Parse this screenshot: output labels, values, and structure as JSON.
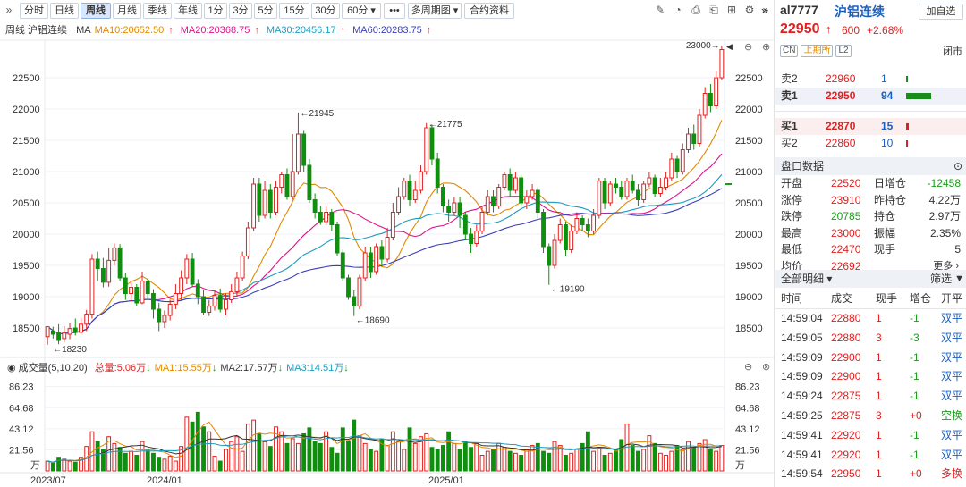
{
  "toolbar": {
    "expand_left": "»",
    "periods": [
      "分时",
      "日线",
      "周线",
      "月线",
      "季线",
      "年线",
      "1分",
      "3分",
      "5分",
      "15分",
      "30分"
    ],
    "active_period": "周线",
    "period_select": "60分 ▾",
    "more": "•••",
    "multi_period": "多周期图 ▾",
    "contract_info": "合约资料",
    "expand_right": "»"
  },
  "ma_legend": {
    "title": "周线 沪铝连续",
    "ma_label": "MA",
    "items": [
      {
        "text": "MA10:20652.50",
        "color": "#e08a00"
      },
      {
        "text": "MA20:20368.75",
        "color": "#e0138c"
      },
      {
        "text": "MA30:20456.17",
        "color": "#1c9bbf"
      },
      {
        "text": "MA60:20283.75",
        "color": "#3a3fb8"
      }
    ]
  },
  "vol_legend": {
    "title": "成交量(5,10,20)",
    "total": "总量:5.06万",
    "items": [
      {
        "text": "MA1:15.55万",
        "color": "#e08a00"
      },
      {
        "text": "MA2:17.57万",
        "color": "#333333"
      },
      {
        "text": "MA3:14.51万",
        "color": "#1c9bbf"
      }
    ]
  },
  "axis": {
    "price_ticks": [
      "22500",
      "22000",
      "21500",
      "21000",
      "20500",
      "20000",
      "19500",
      "19000",
      "18500"
    ],
    "vol_ticks": [
      "86.23",
      "64.68",
      "43.12",
      "21.56"
    ],
    "vol_unit": "万",
    "dates": [
      "2023/07",
      "2024/01",
      "2025/01"
    ]
  },
  "annotations": {
    "high": "23000",
    "p21945": "←21945",
    "p21775": "←21775",
    "p18690": "←18690",
    "p19190": "←19190",
    "p18230": "←18230"
  },
  "chart_data": {
    "type": "candlestick",
    "title": "周线 沪铝连续",
    "ylim": [
      18100,
      23100
    ],
    "vol_ylim": [
      0,
      96
    ],
    "candles": [
      [
        18360,
        18520,
        18230,
        18450
      ],
      [
        18450,
        18400,
        18330,
        18520
      ],
      [
        18420,
        18300,
        18240,
        18560
      ],
      [
        18330,
        18420,
        18270,
        18530
      ],
      [
        18400,
        18490,
        18320,
        18580
      ],
      [
        18500,
        18430,
        18380,
        18650
      ],
      [
        18430,
        18560,
        18400,
        18670
      ],
      [
        18560,
        18720,
        18450,
        18790
      ],
      [
        18720,
        19600,
        18650,
        19680
      ],
      [
        19600,
        19450,
        19250,
        19720
      ],
      [
        19450,
        19230,
        19150,
        19620
      ],
      [
        19230,
        19580,
        19160,
        19780
      ],
      [
        19580,
        19780,
        19500,
        19850
      ],
      [
        19780,
        19300,
        19250,
        19840
      ],
      [
        19300,
        19050,
        18950,
        19380
      ],
      [
        19050,
        19150,
        18920,
        19250
      ],
      [
        19150,
        18900,
        18850,
        19200
      ],
      [
        18900,
        19250,
        18880,
        19400
      ],
      [
        19250,
        19050,
        18950,
        19290
      ],
      [
        19050,
        18800,
        18650,
        19120
      ],
      [
        18800,
        18600,
        18450,
        18900
      ],
      [
        18600,
        18700,
        18500,
        18780
      ],
      [
        18700,
        18880,
        18620,
        18950
      ],
      [
        18880,
        19050,
        18800,
        19200
      ],
      [
        19050,
        19300,
        18950,
        19420
      ],
      [
        19300,
        19600,
        19200,
        19680
      ],
      [
        19600,
        19200,
        19150,
        19700
      ],
      [
        19200,
        19000,
        18880,
        19280
      ],
      [
        19000,
        18750,
        18700,
        19100
      ],
      [
        18750,
        18850,
        18690,
        18950
      ],
      [
        18850,
        19020,
        18780,
        19100
      ],
      [
        19020,
        18800,
        18750,
        19130
      ],
      [
        18800,
        18950,
        18700,
        19050
      ],
      [
        18950,
        19080,
        18900,
        19200
      ],
      [
        19080,
        19300,
        19000,
        19400
      ],
      [
        19300,
        19650,
        19250,
        19720
      ],
      [
        19650,
        20100,
        19600,
        20200
      ],
      [
        20100,
        20800,
        20050,
        20900
      ],
      [
        20800,
        20300,
        20200,
        20900
      ],
      [
        20300,
        20700,
        20250,
        20850
      ],
      [
        20700,
        20350,
        20250,
        20800
      ],
      [
        20350,
        20750,
        20300,
        20850
      ],
      [
        20750,
        20950,
        20650,
        21000
      ],
      [
        20950,
        20600,
        20550,
        21050
      ],
      [
        20600,
        21000,
        20550,
        21600
      ],
      [
        21000,
        21600,
        20950,
        21945
      ],
      [
        21600,
        21100,
        21000,
        21650
      ],
      [
        21100,
        20550,
        20500,
        21200
      ],
      [
        20550,
        20350,
        20250,
        20650
      ],
      [
        20350,
        20200,
        20150,
        20450
      ],
      [
        20200,
        20350,
        20150,
        20450
      ],
      [
        20350,
        20150,
        20050,
        20400
      ],
      [
        20150,
        19700,
        19650,
        20200
      ],
      [
        19700,
        19300,
        19250,
        19750
      ],
      [
        19300,
        19000,
        18950,
        19350
      ],
      [
        19000,
        18850,
        18690,
        19100
      ],
      [
        18850,
        19300,
        18800,
        19350
      ],
      [
        19300,
        19700,
        19250,
        19800
      ],
      [
        19700,
        19400,
        19300,
        19800
      ],
      [
        19400,
        19800,
        19350,
        19850
      ],
      [
        19800,
        19600,
        19500,
        19900
      ],
      [
        19600,
        19950,
        19550,
        20100
      ],
      [
        19950,
        20350,
        19900,
        20500
      ],
      [
        20350,
        20600,
        20300,
        20750
      ],
      [
        20600,
        20850,
        20550,
        20900
      ],
      [
        20850,
        20550,
        20450,
        20950
      ],
      [
        20550,
        20700,
        20500,
        20850
      ],
      [
        20700,
        21000,
        20650,
        21100
      ],
      [
        21000,
        21700,
        20950,
        21775
      ],
      [
        21700,
        21200,
        21100,
        21750
      ],
      [
        21200,
        20750,
        20650,
        21300
      ],
      [
        20750,
        20450,
        20350,
        20800
      ],
      [
        20450,
        20350,
        20200,
        20550
      ],
      [
        20350,
        20500,
        20300,
        20600
      ],
      [
        20500,
        20300,
        20100,
        20600
      ],
      [
        20300,
        20000,
        19900,
        20350
      ],
      [
        20000,
        19850,
        19700,
        20100
      ],
      [
        19850,
        20050,
        19800,
        20150
      ],
      [
        20050,
        20350,
        20000,
        20450
      ],
      [
        20350,
        20600,
        20300,
        20700
      ],
      [
        20600,
        20450,
        20350,
        20700
      ],
      [
        20450,
        20750,
        20400,
        20800
      ],
      [
        20750,
        20950,
        20700,
        21000
      ],
      [
        20950,
        20700,
        20600,
        21050
      ],
      [
        20700,
        20900,
        20650,
        21000
      ],
      [
        20900,
        20500,
        20450,
        20950
      ],
      [
        20500,
        20600,
        20400,
        20700
      ],
      [
        20600,
        20700,
        20550,
        20800
      ],
      [
        20700,
        20350,
        20250,
        20750
      ],
      [
        20350,
        19800,
        19700,
        20400
      ],
      [
        19800,
        19500,
        19190,
        19850
      ],
      [
        19500,
        19900,
        19450,
        20000
      ],
      [
        19900,
        20150,
        19850,
        20250
      ],
      [
        20150,
        19750,
        19650,
        20200
      ],
      [
        19750,
        20050,
        19700,
        20150
      ],
      [
        20050,
        20250,
        20000,
        20350
      ],
      [
        20250,
        20150,
        20050,
        20300
      ],
      [
        20150,
        20050,
        19950,
        20250
      ],
      [
        20050,
        20300,
        20000,
        20400
      ],
      [
        20300,
        20850,
        20250,
        20900
      ],
      [
        20850,
        20500,
        20400,
        20900
      ],
      [
        20500,
        20800,
        20450,
        20850
      ],
      [
        20800,
        20750,
        20650,
        20900
      ],
      [
        20750,
        20600,
        20550,
        20850
      ],
      [
        20600,
        20850,
        20550,
        20900
      ],
      [
        20850,
        20700,
        20650,
        20950
      ],
      [
        20700,
        20550,
        20450,
        20800
      ],
      [
        20550,
        20800,
        20500,
        20850
      ],
      [
        20800,
        20900,
        20750,
        21000
      ],
      [
        20900,
        20650,
        20600,
        20950
      ],
      [
        20650,
        20750,
        20600,
        20900
      ],
      [
        20750,
        20900,
        20700,
        21000
      ],
      [
        20900,
        21200,
        20850,
        21300
      ],
      [
        21200,
        21000,
        20900,
        21250
      ],
      [
        21000,
        21350,
        20950,
        21450
      ],
      [
        21350,
        21600,
        21300,
        21700
      ],
      [
        21600,
        21450,
        21350,
        21750
      ],
      [
        21450,
        21900,
        21400,
        22000
      ],
      [
        21900,
        22250,
        21850,
        22350
      ],
      [
        22250,
        22050,
        21950,
        22400
      ],
      [
        22050,
        22500,
        22000,
        22600
      ],
      [
        22500,
        22950,
        22470,
        23000
      ]
    ],
    "volumes": [
      10,
      8,
      14,
      12,
      10,
      9,
      14,
      25,
      40,
      30,
      22,
      35,
      28,
      24,
      18,
      20,
      16,
      30,
      22,
      18,
      14,
      12,
      15,
      10,
      25,
      55,
      50,
      60,
      45,
      40,
      15,
      10,
      22,
      30,
      35,
      20,
      48,
      52,
      38,
      30,
      25,
      45,
      40,
      28,
      33,
      28,
      38,
      44,
      30,
      28,
      40,
      24,
      18,
      44,
      30,
      52,
      36,
      28,
      22,
      20,
      32,
      26,
      40,
      30,
      22,
      44,
      28,
      35,
      38,
      24,
      22,
      26,
      40,
      28,
      22,
      30,
      24,
      28,
      16,
      20,
      22,
      28,
      24,
      20,
      18,
      16,
      22,
      26,
      28,
      20,
      18,
      30,
      26,
      16,
      18,
      22,
      28,
      40,
      20,
      24,
      16,
      18,
      22,
      32,
      48,
      26,
      20,
      22,
      36,
      28,
      18,
      16,
      20,
      26,
      22,
      30,
      24,
      28,
      32,
      22,
      20,
      26
    ]
  },
  "quote": {
    "symbol": "al7777",
    "name": "沪铝连续",
    "price": "22950",
    "arrow": "↑",
    "change": "600",
    "pct": "+2.68%",
    "add_fav": "加自选",
    "tags": [
      "CN",
      "上期所",
      "L2"
    ],
    "status": "闭市"
  },
  "orderbook": [
    {
      "label": "卖2",
      "price": "22960",
      "qty": "1",
      "bar": 0
    },
    {
      "label": "卖1",
      "price": "22950",
      "qty": "94",
      "bar": 1
    },
    {
      "label": "买1",
      "price": "22870",
      "qty": "15",
      "bar": 0.1
    },
    {
      "label": "买2",
      "price": "22860",
      "qty": "10",
      "bar": 0.07
    }
  ],
  "panel_title": "盘口数据",
  "stats": [
    [
      "开盘",
      "22520",
      "日增仓",
      "-12458"
    ],
    [
      "涨停",
      "23910",
      "昨持仓",
      "4.22万"
    ],
    [
      "跌停",
      "20785",
      "持仓",
      "2.97万"
    ],
    [
      "最高",
      "23000",
      "振幅",
      "2.35%"
    ],
    [
      "最低",
      "22470",
      "现手",
      "5"
    ],
    [
      "均价",
      "22692",
      "更多 ›",
      ""
    ]
  ],
  "ticks": {
    "title": "全部明细 ▾",
    "filter": "筛选",
    "headers": [
      "时间",
      "成交",
      "现手",
      "增仓",
      "开平"
    ],
    "rows": [
      [
        "14:59:04",
        "22880",
        "1",
        "-1",
        "双平"
      ],
      [
        "14:59:05",
        "22880",
        "3",
        "-3",
        "双平"
      ],
      [
        "14:59:09",
        "22900",
        "1",
        "-1",
        "双平"
      ],
      [
        "14:59:09",
        "22900",
        "1",
        "-1",
        "双平"
      ],
      [
        "14:59:24",
        "22875",
        "1",
        "-1",
        "双平"
      ],
      [
        "14:59:25",
        "22875",
        "3",
        "+0",
        "空换"
      ],
      [
        "14:59:41",
        "22920",
        "1",
        "-1",
        "双平"
      ],
      [
        "14:59:41",
        "22920",
        "1",
        "-1",
        "双平"
      ],
      [
        "14:59:54",
        "22950",
        "1",
        "+0",
        "多换"
      ]
    ]
  }
}
